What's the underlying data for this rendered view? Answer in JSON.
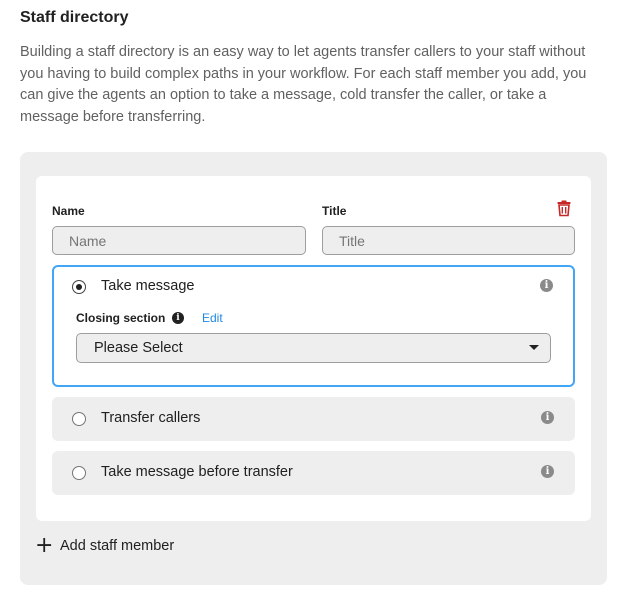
{
  "header": {
    "title": "Staff directory",
    "description": "Building a staff directory is an easy way to let agents transfer callers to your staff without you having to build complex paths in your workflow. For each staff member you add, you can give the agents an option to take a message, cold transfer the caller, or take a message before transferring."
  },
  "staff_card": {
    "name_label": "Name",
    "name_placeholder": "Name",
    "name_value": "",
    "title_label": "Title",
    "title_placeholder": "Title",
    "title_value": "",
    "delete_icon": "trash-icon",
    "delete_color": "#c62828",
    "options": [
      {
        "label": "Take message",
        "selected": true
      },
      {
        "label": "Transfer callers",
        "selected": false
      },
      {
        "label": "Take message before transfer",
        "selected": false
      }
    ],
    "closing_section": {
      "label": "Closing section",
      "edit_label": "Edit",
      "select_value": "Please Select"
    }
  },
  "add_member": {
    "label": "Add staff member",
    "icon": "plus-icon"
  },
  "colors": {
    "accent": "#42a5f5",
    "link": "#1e88e5",
    "panel": "#eeeeee"
  }
}
